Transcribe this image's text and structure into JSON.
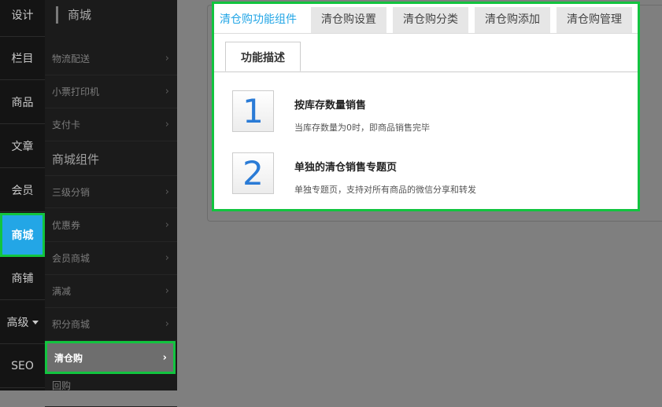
{
  "rail": {
    "items": [
      {
        "label": "设计"
      },
      {
        "label": "栏目"
      },
      {
        "label": "商品"
      },
      {
        "label": "文章"
      },
      {
        "label": "会员"
      },
      {
        "label": "商城"
      },
      {
        "label": "商铺"
      },
      {
        "label": "高级"
      },
      {
        "label": "SEO"
      }
    ]
  },
  "subnav": {
    "title": "商城",
    "items_top": [
      {
        "label": "物流配送"
      },
      {
        "label": "小票打印机"
      },
      {
        "label": "支付卡"
      }
    ],
    "section": "商城组件",
    "items_components": [
      {
        "label": "三级分销"
      },
      {
        "label": "优惠券"
      },
      {
        "label": "会员商城"
      },
      {
        "label": "满减"
      },
      {
        "label": "积分商城"
      },
      {
        "label": "清仓购"
      },
      {
        "label": "回购"
      }
    ],
    "arrow": "›"
  },
  "tabs": [
    {
      "label": "清仓购功能组件"
    },
    {
      "label": "清仓购设置"
    },
    {
      "label": "清仓购分类"
    },
    {
      "label": "清仓购添加"
    },
    {
      "label": "清仓购管理"
    }
  ],
  "subtab": {
    "label": "功能描述"
  },
  "features": [
    {
      "num": "1",
      "title": "按库存数量销售",
      "desc": "当库存数量为0时，即商品销售完毕"
    },
    {
      "num": "2",
      "title": "单独的清仓销售专题页",
      "desc": "单独专题页，支持对所有商品的微信分享和转发"
    }
  ],
  "colors": {
    "accent": "#23a6e6",
    "highlight_border": "#12c43f",
    "rail_bg": "#141414",
    "overlay_bg": "#7f7f7f"
  }
}
